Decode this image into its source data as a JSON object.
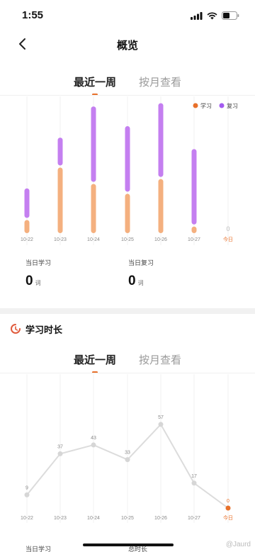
{
  "status": {
    "time": "1:55"
  },
  "nav": {
    "title": "概览"
  },
  "tabs": {
    "week": "最近一周",
    "month": "按月查看"
  },
  "legend": {
    "learn": "学习",
    "review": "复习"
  },
  "colors": {
    "accent": "#e8702a",
    "learn": "#f4b07f",
    "review": "#c47ff0",
    "line": "#d9d9d9"
  },
  "chart_data": [
    {
      "type": "bar",
      "stacked": true,
      "categories": [
        "10-22",
        "10-23",
        "10-24",
        "10-25",
        "10-26",
        "10-27",
        "今日"
      ],
      "series": [
        {
          "name": "学习",
          "values": [
            8,
            40,
            30,
            24,
            33,
            4,
            0
          ]
        },
        {
          "name": "复习",
          "values": [
            18,
            17,
            46,
            40,
            45,
            46,
            0
          ]
        }
      ],
      "today_value_label": "0",
      "legend_position": "top-right",
      "ylim": [
        0,
        80
      ]
    },
    {
      "type": "line",
      "categories": [
        "10-22",
        "10-23",
        "10-24",
        "10-25",
        "10-26",
        "10-27",
        "今日"
      ],
      "values": [
        9,
        37,
        43,
        33,
        57,
        17,
        0
      ],
      "ylim": [
        0,
        70
      ]
    }
  ],
  "stats": {
    "today_learn_label": "当日学习",
    "today_learn_value": "0",
    "today_review_label": "当日复习",
    "today_review_value": "0",
    "unit": "词"
  },
  "duration": {
    "title": "学习时长",
    "today_learn_label": "当日学习",
    "total_label": "总时长"
  },
  "watermark": "@Jaurd"
}
